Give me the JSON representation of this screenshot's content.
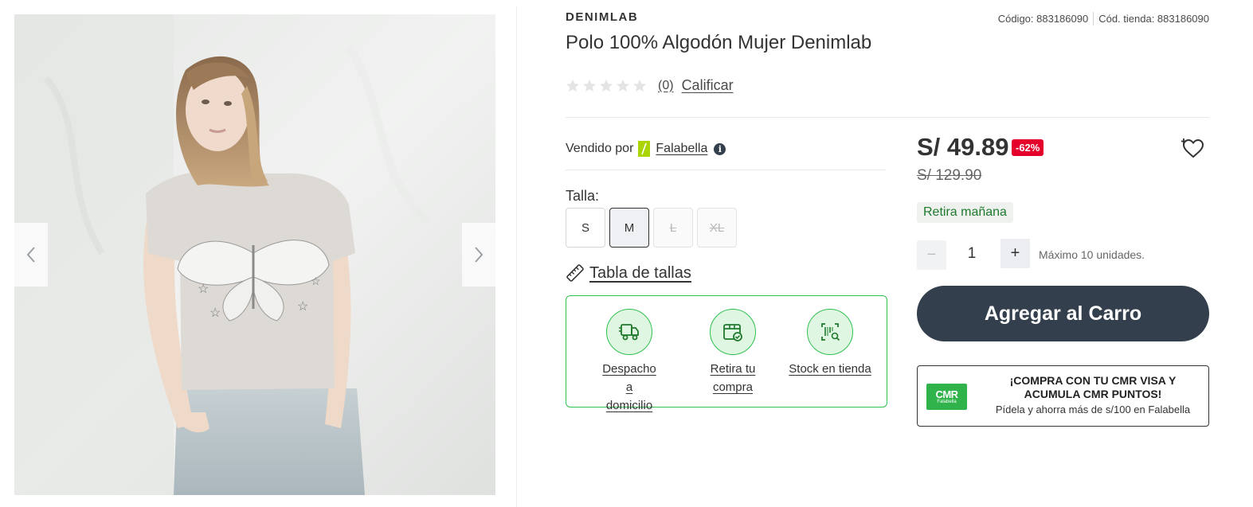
{
  "product": {
    "brand": "DENIMLAB",
    "title": "Polo 100% Algodón Mujer Denimlab",
    "code_label": "Código: 883186090",
    "store_code_label": "Cód. tienda: 883186090",
    "image_alt": "Mujer con polo gris con estampado de mariposa"
  },
  "rating": {
    "count": "(0)",
    "rate_link": "Calificar",
    "stars": 5
  },
  "seller": {
    "prefix": "Vendido por",
    "name": "Falabella",
    "logo_color": "#aad500"
  },
  "sizes": {
    "label": "Talla:",
    "options": [
      "S",
      "M",
      "L",
      "XL"
    ],
    "selected": "M",
    "unavailable": [
      "L",
      "XL"
    ],
    "guide_label": "Tabla de tallas"
  },
  "delivery_options": [
    {
      "line1": "Despacho a",
      "line2": "domicilio",
      "icon": "truck-icon"
    },
    {
      "line1": "Retira tu",
      "line2": "compra",
      "icon": "store-pickup-icon"
    },
    {
      "line1": "Stock en tienda",
      "line2": "",
      "icon": "barcode-search-icon"
    }
  ],
  "price": {
    "current": "S/ 49.89",
    "discount": "-62%",
    "original": "S/ 129.90",
    "pickup_badge": "Retira mañana"
  },
  "quantity": {
    "minus": "−",
    "value": "1",
    "plus": "+",
    "note": "Máximo 10 unidades."
  },
  "cart": {
    "button_label": "Agregar al Carro"
  },
  "cmr": {
    "logo_big": "CMR",
    "logo_small": "Falabella",
    "title_line1": "¡COMPRA CON TU CMR VISA Y",
    "title_line2": "ACUMULA CMR PUNTOS!",
    "subtitle": "Pídela y ahorra más de s/100 en Falabella"
  },
  "colors": {
    "accent_green": "#30c04f",
    "discount_red": "#e4002b",
    "cart_button": "#333f4c"
  }
}
